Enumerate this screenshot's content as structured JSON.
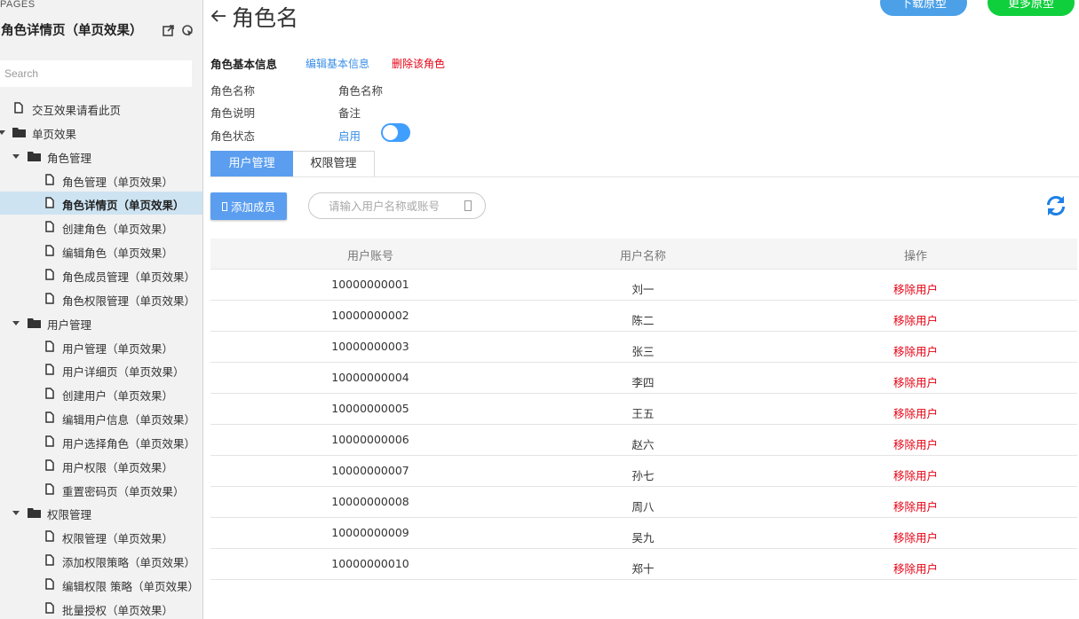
{
  "sidebar": {
    "pages_label": "PAGES",
    "title": "角色详情页（单页效果）",
    "search_placeholder": "Search",
    "tree": [
      {
        "label": "交互效果请看此页",
        "type": "page",
        "level": 0
      },
      {
        "label": "单页效果",
        "type": "folder",
        "level": 0,
        "expanded": true
      },
      {
        "label": "角色管理",
        "type": "folder",
        "level": 1,
        "expanded": true
      },
      {
        "label": "角色管理（单页效果）",
        "type": "page",
        "level": 2
      },
      {
        "label": "角色详情页（单页效果）",
        "type": "page",
        "level": 2,
        "selected": true
      },
      {
        "label": "创建角色（单页效果）",
        "type": "page",
        "level": 2
      },
      {
        "label": "编辑角色（单页效果）",
        "type": "page",
        "level": 2
      },
      {
        "label": "角色成员管理（单页效果）",
        "type": "page",
        "level": 2
      },
      {
        "label": "角色权限管理（单页效果）",
        "type": "page",
        "level": 2
      },
      {
        "label": "用户管理",
        "type": "folder",
        "level": 1,
        "expanded": true
      },
      {
        "label": "用户管理（单页效果）",
        "type": "page",
        "level": 2
      },
      {
        "label": "用户详细页（单页效果）",
        "type": "page",
        "level": 2
      },
      {
        "label": "创建用户（单页效果）",
        "type": "page",
        "level": 2
      },
      {
        "label": "编辑用户信息（单页效果）",
        "type": "page",
        "level": 2
      },
      {
        "label": "用户选择角色（单页效果）",
        "type": "page",
        "level": 2
      },
      {
        "label": "用户权限（单页效果）",
        "type": "page",
        "level": 2
      },
      {
        "label": "重置密码页（单页效果）",
        "type": "page",
        "level": 2
      },
      {
        "label": "权限管理",
        "type": "folder",
        "level": 1,
        "expanded": true
      },
      {
        "label": "权限管理（单页效果）",
        "type": "page",
        "level": 2
      },
      {
        "label": "添加权限策略（单页效果）",
        "type": "page",
        "level": 2
      },
      {
        "label": "编辑权限 策略（单页效果）",
        "type": "page",
        "level": 2
      },
      {
        "label": "批量授权（单页效果）",
        "type": "page",
        "level": 2
      }
    ]
  },
  "header": {
    "title": "角色名",
    "download_label": "下载原型",
    "more_label": "更多原型"
  },
  "info": {
    "heading": "角色基本信息",
    "edit_label": "编辑基本信息",
    "delete_label": "删除该角色",
    "name_label": "角色名称",
    "name_value": "角色名称",
    "desc_label": "角色说明",
    "desc_value": "备注",
    "status_label": "角色状态",
    "status_value": "启用",
    "status_on": true
  },
  "tabs": [
    {
      "label": "用户管理",
      "active": true
    },
    {
      "label": "权限管理",
      "active": false
    }
  ],
  "toolbar": {
    "add_label": "添加成员",
    "search_placeholder": "请输入用户名称或账号"
  },
  "table": {
    "columns": [
      "用户账号",
      "用户名称",
      "操作"
    ],
    "rows": [
      {
        "account": "10000000001",
        "name": "刘一",
        "action": "移除用户"
      },
      {
        "account": "10000000002",
        "name": "陈二",
        "action": "移除用户"
      },
      {
        "account": "10000000003",
        "name": "张三",
        "action": "移除用户"
      },
      {
        "account": "10000000004",
        "name": "李四",
        "action": "移除用户"
      },
      {
        "account": "10000000005",
        "name": "王五",
        "action": "移除用户"
      },
      {
        "account": "10000000006",
        "name": "赵六",
        "action": "移除用户"
      },
      {
        "account": "10000000007",
        "name": "孙七",
        "action": "移除用户"
      },
      {
        "account": "10000000008",
        "name": "周八",
        "action": "移除用户"
      },
      {
        "account": "10000000009",
        "name": "吴九",
        "action": "移除用户"
      },
      {
        "account": "10000000010",
        "name": "郑十",
        "action": "移除用户"
      }
    ]
  },
  "colors": {
    "primary": "#5b9ef0",
    "link": "#3a8ee6",
    "danger": "#e60012",
    "download_bg": "#4ba0e8",
    "more_bg": "#0fcf3c",
    "selected_row": "#cde3f2"
  },
  "icons": {
    "back": "arrow-left-icon",
    "export": "export-icon",
    "locate": "locate-icon",
    "refresh": "refresh-icon",
    "page": "page-icon",
    "folder": "folder-icon"
  }
}
